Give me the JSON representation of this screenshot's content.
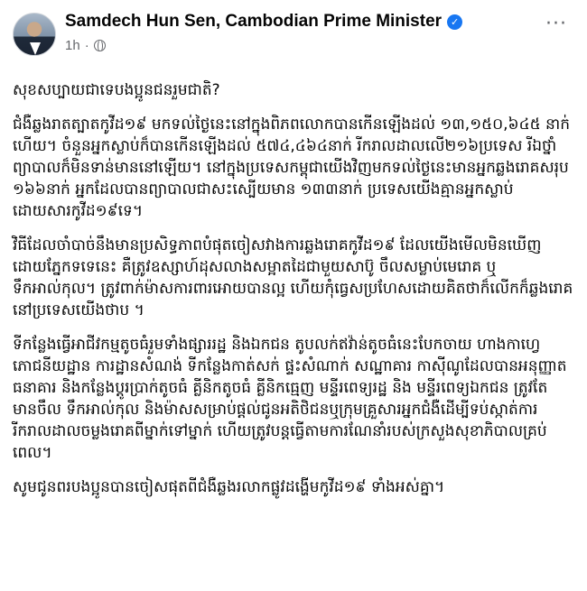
{
  "post": {
    "page_name": "Samdech Hun Sen, Cambodian Prime Minister",
    "verified_icon": "verified-badge-icon",
    "timestamp": "1h",
    "separator": "·",
    "audience_icon": "globe-icon",
    "more_label": "···",
    "accent_color": "#1877f2",
    "paragraphs": [
      "សុខសប្បាយជាទេបងប្អូនជនរួមជាតិ?",
      "ជំងឺឆ្លងរាតត្បាតកូវីដ១៩ មកទល់ថ្ងៃនេះនៅក្នុងពិភពលោកបានកើនឡើងដល់ ១៣,១៥០,៦៤៥ នាក់ហើយ។ ចំនួនអ្នកស្លាប់ក៏បានកើនឡើងដល់ ៥៧៤,៤៦៤នាក់ រីករាលដាលលើ២១៦ប្រទេស រីឯថ្នាំព្យាបាលក៏មិនទាន់មាននៅឡើយ។ នៅក្នុងប្រទេសកម្ពុជាយើងវិញមកទល់ថ្ងៃនេះមានអ្នកឆ្លងរោគសរុប ១៦៦នាក់ អ្នកដែលបានព្យាបាលជាសះស្បើយមាន ១៣៣នាក់ ប្រទេសយើងគ្មានអ្នកស្លាប់ដោយសារកូវីដ១៩ទេ។",
      "វិធីដែលចាំបាច់នឹងមានប្រសិទ្ធភាពបំផុតចៀសវាងការឆ្លងរោគកូវីដ១៩ ដែលយើងមើលមិនឃើញដោយភ្នែកទទេនេះ គឺត្រូវឧស្សាហ៍ដុសលាងសម្អាតដៃជាមួយសាប៊ូ ចឹលសម្លាប់មេរោគ ឬទឹកអាល់កុល។ ត្រូវពាក់ម៉ាសការពារអោយបានល្អ ហើយកុំធ្វេសប្រហែសដោយគិតថាក៏លើកក៏ឆ្លងរោគនៅប្រទេសយើងថាប ។",
      "ទីកន្លែងធ្វើអាជីវកម្មតូចធំរួមទាំងផ្សាររដ្ឋ និងឯកជន តូបលក់ឥវ៉ាន់តូចធំនេះបែកចាយ ហាងកាហ្វេ ភោជនីយដ្ឋាន ការដ្ឋានសំណង់ ទីកន្លែងកាត់សក់ ផ្ទះសំណាក់ សណ្ឋាគារ កាស៊ីណូដែលបានអនុញ្ញាត ធនាគារ និងកន្លែងប្តូរប្រាក់តូចធំ គ្លីនិកតូចធំ គ្លីនិកធ្មេញ មន្ទីរពេទ្យរដ្ឋ និង មន្ទីរពេទ្យឯកជន ត្រូវតែមានចឹល ទឹកអាល់កុល និងម៉ាសសម្រាប់ផ្តល់ជូនអតិថិជនឬក្រុមគ្រួសារអ្នកជំងឺដើម្បីទប់ស្កាត់ការរីករាលដាលចម្លងរោគពីម្នាក់ទៅម្នាក់ ហើយត្រូវបន្តធ្វើតាមការណែនាំរបស់ក្រសួងសុខាភិបាលគ្រប់ពេល។",
      "សូមជូនពរបងប្អូនបានចៀសផុតពីជំងឺឆ្លងរលាកផ្លូវដង្ហើមកូវីដ១៩ ទាំងអស់គ្នា។"
    ]
  }
}
